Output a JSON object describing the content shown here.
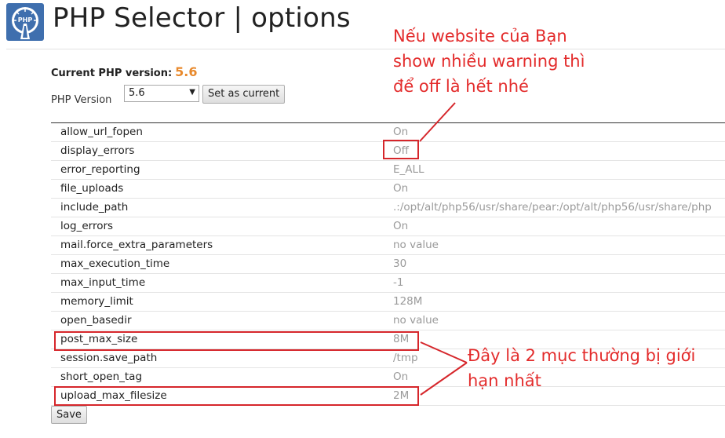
{
  "header": {
    "title": "PHP Selector | options",
    "logo_text": "PHP"
  },
  "current_version": {
    "label": "Current PHP version:",
    "value": "5.6"
  },
  "version_selector": {
    "label": "PHP Version",
    "selected": "5.6",
    "set_button_label": "Set as current"
  },
  "options": [
    {
      "name": "allow_url_fopen",
      "value": "On"
    },
    {
      "name": "display_errors",
      "value": "Off"
    },
    {
      "name": "error_reporting",
      "value": "E_ALL"
    },
    {
      "name": "file_uploads",
      "value": "On"
    },
    {
      "name": "include_path",
      "value": ".:/opt/alt/php56/usr/share/pear:/opt/alt/php56/usr/share/php"
    },
    {
      "name": "log_errors",
      "value": "On"
    },
    {
      "name": "mail.force_extra_parameters",
      "value": "no value"
    },
    {
      "name": "max_execution_time",
      "value": "30"
    },
    {
      "name": "max_input_time",
      "value": "-1"
    },
    {
      "name": "memory_limit",
      "value": "128M"
    },
    {
      "name": "open_basedir",
      "value": "no value"
    },
    {
      "name": "post_max_size",
      "value": "8M"
    },
    {
      "name": "session.save_path",
      "value": "/tmp"
    },
    {
      "name": "short_open_tag",
      "value": "On"
    },
    {
      "name": "upload_max_filesize",
      "value": "2M"
    }
  ],
  "save_button_label": "Save",
  "annotations": {
    "top_note": {
      "line1": "Nếu website của Bạn",
      "line2": "show nhiều warning thì",
      "line3": "để off là hết nhé"
    },
    "bottom_note": {
      "line1": "Đây là 2 mục thường bị giới",
      "line2": "hạn nhất"
    }
  },
  "colors": {
    "version_accent": "#e8892c",
    "annotation_red": "#e32b2b",
    "value_gray": "#9a9a9a"
  }
}
